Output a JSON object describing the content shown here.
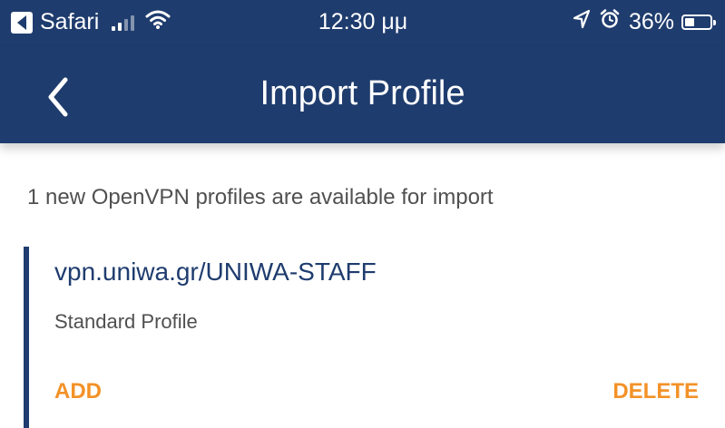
{
  "status_bar": {
    "app_name": "Safari",
    "time": "12:30 μμ",
    "battery": "36%",
    "icons": [
      "back-app-icon",
      "signal-icon",
      "wifi-icon",
      "location-icon",
      "alarm-icon",
      "battery-icon"
    ]
  },
  "nav_bar": {
    "title": "Import Profile",
    "back_icon": "chevron-left-icon"
  },
  "main": {
    "intro": "1 new OpenVPN profiles are available for import",
    "profiles": [
      {
        "name": "vpn.uniwa.gr/UNIWA-STAFF",
        "type": "Standard Profile",
        "add_label": "ADD",
        "delete_label": "DELETE"
      }
    ]
  },
  "colors": {
    "brand": "#1f3c6e",
    "accent": "#f39228",
    "text_secondary": "#505050",
    "background": "#ffffff"
  }
}
